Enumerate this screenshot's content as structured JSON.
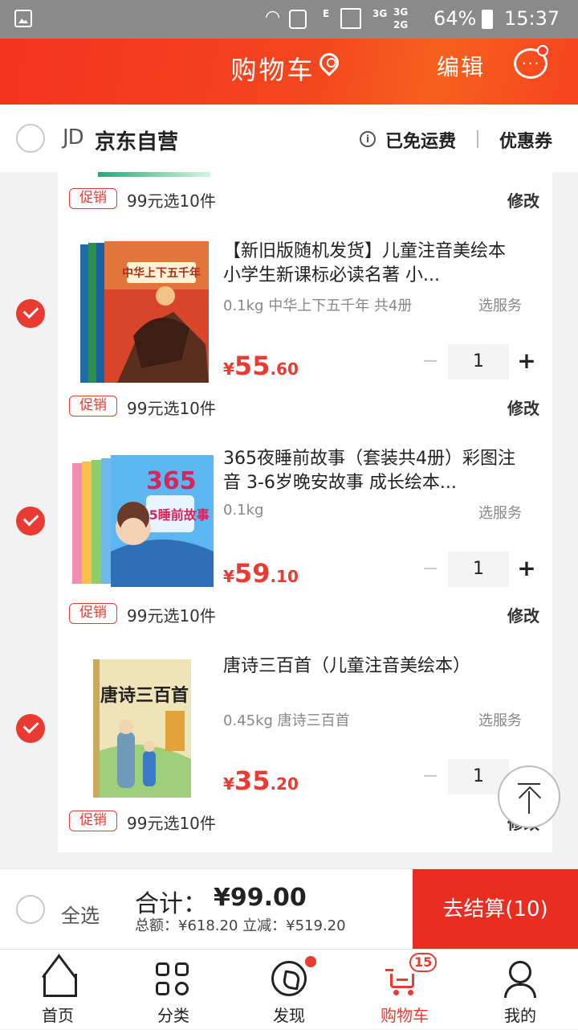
{
  "status_bar": {
    "network_a": "E",
    "network_b": "3G",
    "network_c": "3G",
    "network_d": "2G",
    "battery": "64%",
    "time": "15:37"
  },
  "header": {
    "title": "购物车",
    "edit_label": "编辑",
    "icons": [
      "location-icon",
      "message-icon"
    ]
  },
  "shop": {
    "logo_text": "JD",
    "name": "京东自营",
    "shipping": "已免运费",
    "coupon": "优惠券"
  },
  "promo": {
    "tag": "促销",
    "text": "99元选10件",
    "edit": "修改"
  },
  "items": [
    {
      "title": "【新旧版随机发货】儿童注音美绘本 小学生新课标必读名著 小...",
      "spec": "0.1kg 中华上下五千年 共4册",
      "service": "选服务",
      "price_symbol": "¥",
      "price_int": "55",
      "price_dec": ".60",
      "qty": "1",
      "minus": "−",
      "plus": "+",
      "checked": true,
      "cover_text": "中华上下五千年"
    },
    {
      "title": "365夜睡前故事（套装共4册）彩图注音 3-6岁晚安故事 成长绘本...",
      "spec": "0.1kg",
      "service": "选服务",
      "price_symbol": "¥",
      "price_int": "59",
      "price_dec": ".10",
      "qty": "1",
      "minus": "−",
      "plus": "+",
      "checked": true,
      "cover_text": "365睡前故事"
    },
    {
      "title": "唐诗三百首（儿童注音美绘本）",
      "spec": "0.45kg 唐诗三百首",
      "service": "选服务",
      "price_symbol": "¥",
      "price_int": "35",
      "price_dec": ".20",
      "qty": "1",
      "minus": "−",
      "plus": "+",
      "checked": true,
      "cover_text": "唐诗三百首"
    }
  ],
  "summary": {
    "select_all": "全选",
    "total_label": "合计：",
    "total_value": "¥99.00",
    "gross": "总额：¥618.20 立减：¥519.20",
    "checkout": "去结算(10)"
  },
  "nav": {
    "items": [
      {
        "label": "首页",
        "icon": "home-icon"
      },
      {
        "label": "分类",
        "icon": "category-icon"
      },
      {
        "label": "发现",
        "icon": "discover-icon"
      },
      {
        "label": "购物车",
        "icon": "cart-icon"
      },
      {
        "label": "我的",
        "icon": "profile-icon"
      }
    ],
    "cart_badge": "15"
  },
  "colors": {
    "brand_red": "#e93b32",
    "header_gradient_start": "#f5331f",
    "checkout_bg": "#ea2d21"
  }
}
